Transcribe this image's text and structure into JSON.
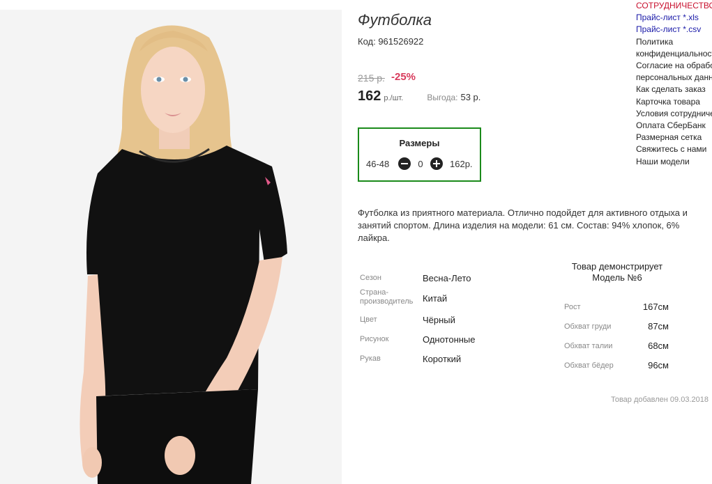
{
  "product": {
    "title": "Футболка",
    "code": "Код: 961526922",
    "old_price": "215 р.",
    "discount": "-25%",
    "price": "162",
    "unit": "р./шт.",
    "benefit_label": "Выгода:",
    "benefit_value": "53 р."
  },
  "sizes": {
    "title": "Размеры",
    "items": [
      {
        "size": "46-48",
        "qty": "0",
        "price": "162р."
      }
    ]
  },
  "description": "Футболка из приятного материала. Отлично подойдет для активного отдыха и занятий спортом. Длина изделия на модели: 61 см. Состав: 94% хлопок, 6% лайкра.",
  "attributes": [
    {
      "label": "Сезон",
      "value": "Весна-Лето"
    },
    {
      "label": "Страна-производитель",
      "value": "Китай"
    },
    {
      "label": "Цвет",
      "value": "Чёрный"
    },
    {
      "label": "Рисунок",
      "value": "Однотонные"
    },
    {
      "label": "Рукав",
      "value": "Короткий"
    }
  ],
  "model": {
    "title": "Товар демонстрирует Модель №6",
    "params": [
      {
        "label": "Рост",
        "value": "167см"
      },
      {
        "label": "Обхват груди",
        "value": "87см"
      },
      {
        "label": "Обхват талии",
        "value": "68см"
      },
      {
        "label": "Обхват бёдер",
        "value": "96см"
      }
    ]
  },
  "added": "Товар добавлен 09.03.2018",
  "sidebar": {
    "coop": "СОТРУДНИЧЕСТВО",
    "price_links": [
      "Прайс-лист *.xls",
      "Прайс-лист *.csv"
    ],
    "links": [
      "Политика конфиденциальности",
      "Согласие на обработку персональных данных",
      "Как сделать заказ",
      "Карточка товара",
      "Условия сотрудничества",
      "Оплата СберБанк",
      "Размерная сетка",
      "Свяжитесь с нами",
      "Наши модели"
    ]
  },
  "colors": {
    "accent_green": "#1a8a1a",
    "discount_red": "#d83a5b",
    "coop_red": "#c8102e",
    "link_blue": "#1a1aa8"
  }
}
